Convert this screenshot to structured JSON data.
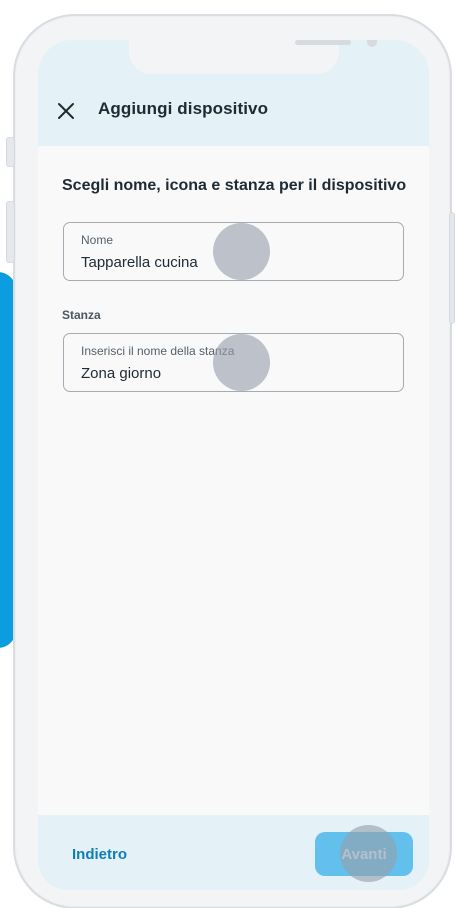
{
  "header": {
    "title": "Aggiungi dispositivo",
    "close_icon": "close-icon"
  },
  "main": {
    "section_title": "Scegli nome, icona e stanza per il dispositivo",
    "name_field": {
      "label": "Nome",
      "value": "Tapparella cucina"
    },
    "room_group_label": "Stanza",
    "room_field": {
      "label": "Inserisci il nome della stanza",
      "value": "Zona giorno"
    }
  },
  "footer": {
    "back_label": "Indietro",
    "next_label": "Avanti"
  },
  "colors": {
    "accent": "#0a9ee0",
    "header_bg": "#e4f1f7",
    "link": "#0f7fb6",
    "primary_button": "#63bfeb"
  }
}
